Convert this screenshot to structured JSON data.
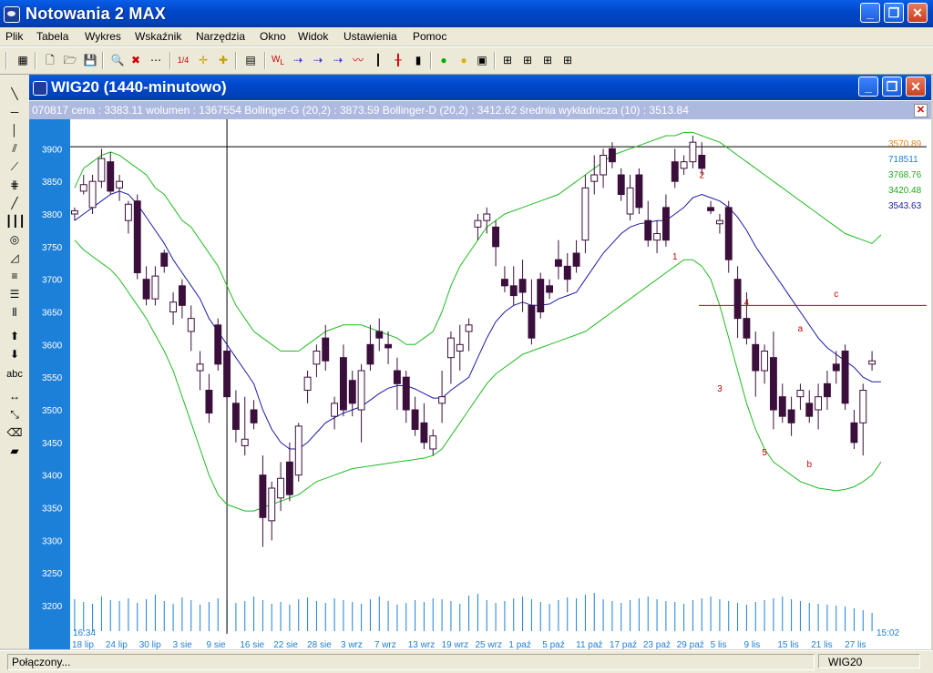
{
  "app": {
    "title": "Notowania 2 MAX"
  },
  "menu": [
    "Plik",
    "Tabela",
    "Wykres",
    "Wskaźnik",
    "Narzędzia",
    "Okno",
    "Widok",
    "Ustawienia",
    "Pomoc"
  ],
  "window": {
    "title": "WIG20 (1440-minutowo)"
  },
  "infobar": {
    "text": "070817  cena : 3383.11 wolumen : 1367554 Bollinger-G (20,2) : 3873.59 Bollinger-D (20,2) : 3412.62 średnia wykładnicza (10) : 3513.84"
  },
  "status": {
    "left": "Połączony...",
    "right": "WIG20"
  },
  "left_tools": [
    "line",
    "hline",
    "vline",
    "channel",
    "fan",
    "fib",
    "parallel",
    "vlines",
    "arc",
    "triangle",
    "ray",
    "hlines",
    "vbars",
    "up",
    "down",
    "abc",
    "arrows",
    "expand",
    "eraser",
    "eraser2"
  ],
  "toolbar_icons": [
    "grid",
    "open-folder",
    "save",
    "zoom",
    "no-zoom",
    "dots",
    "calc",
    "ruler",
    "mark",
    "table",
    "w-lv",
    "link1",
    "link2",
    "link3",
    "line-chart",
    "candles",
    "ohlc",
    "bar",
    "traffic",
    "light",
    "frame",
    "layout1",
    "layout2",
    "layout3",
    "layout4"
  ],
  "chart_data": {
    "type": "candlestick",
    "ylim": [
      3200,
      3920
    ],
    "yticks": [
      3900,
      3850,
      3800,
      3750,
      3700,
      3650,
      3600,
      3550,
      3500,
      3450,
      3400,
      3350,
      3300,
      3250,
      3200
    ],
    "time_label_left": "16:34",
    "time_label_right": "15:02",
    "xticks": [
      "18 lip",
      "24 lip",
      "30 lip",
      "3 sie",
      "9 sie",
      "16 sie",
      "22 sie",
      "28 sie",
      "3 wrz",
      "7 wrz",
      "13 wrz",
      "19 wrz",
      "25 wrz",
      "1 paź",
      "5 paź",
      "11 paź",
      "17 paź",
      "23 paź",
      "29 paź",
      "5 lis",
      "9 lis",
      "15 lis",
      "21 lis",
      "27 lis"
    ],
    "right_values": [
      {
        "text": "3570.89",
        "color": "#e08a1e"
      },
      {
        "text": "718511",
        "color": "#1c7fd8"
      },
      {
        "text": "3768.76",
        "color": "#22aa22"
      },
      {
        "text": "3420.48",
        "color": "#22aa22"
      },
      {
        "text": "3543.63",
        "color": "#1a1aa8"
      }
    ],
    "annotations": [
      {
        "text": "1",
        "x": 67,
        "y": 3730
      },
      {
        "text": "2",
        "x": 70,
        "y": 3855
      },
      {
        "text": "3",
        "x": 72,
        "y": 3528
      },
      {
        "text": "4",
        "x": 75,
        "y": 3660
      },
      {
        "text": "5",
        "x": 77,
        "y": 3430
      },
      {
        "text": "a",
        "x": 81,
        "y": 3620
      },
      {
        "text": "b",
        "x": 82,
        "y": 3412
      },
      {
        "text": "c",
        "x": 85,
        "y": 3673
      }
    ],
    "hline_price": 3660,
    "crosshair": {
      "x_index": 17,
      "price": 3903
    },
    "candles": [
      [
        3800,
        3810,
        3790,
        3805
      ],
      [
        3835,
        3860,
        3830,
        3845
      ],
      [
        3810,
        3860,
        3800,
        3850
      ],
      [
        3850,
        3900,
        3840,
        3885
      ],
      [
        3880,
        3895,
        3830,
        3835
      ],
      [
        3840,
        3860,
        3820,
        3850
      ],
      [
        3790,
        3820,
        3770,
        3815
      ],
      [
        3820,
        3830,
        3700,
        3710
      ],
      [
        3700,
        3720,
        3660,
        3670
      ],
      [
        3670,
        3720,
        3660,
        3705
      ],
      [
        3740,
        3745,
        3710,
        3720
      ],
      [
        3650,
        3680,
        3630,
        3665
      ],
      [
        3690,
        3700,
        3640,
        3660
      ],
      [
        3620,
        3660,
        3590,
        3640
      ],
      [
        3560,
        3590,
        3530,
        3570
      ],
      [
        3530,
        3555,
        3480,
        3495
      ],
      [
        3630,
        3640,
        3560,
        3570
      ],
      [
        3590,
        3600,
        3510,
        3520
      ],
      [
        3510,
        3530,
        3450,
        3470
      ],
      [
        3445,
        3520,
        3430,
        3455
      ],
      [
        3500,
        3515,
        3470,
        3480
      ],
      [
        3400,
        3430,
        3290,
        3335
      ],
      [
        3330,
        3390,
        3300,
        3380
      ],
      [
        3365,
        3420,
        3345,
        3395
      ],
      [
        3420,
        3450,
        3360,
        3370
      ],
      [
        3400,
        3480,
        3390,
        3475
      ],
      [
        3530,
        3560,
        3510,
        3550
      ],
      [
        3570,
        3600,
        3550,
        3590
      ],
      [
        3610,
        3630,
        3560,
        3575
      ],
      [
        3490,
        3520,
        3470,
        3510
      ],
      [
        3580,
        3600,
        3490,
        3500
      ],
      [
        3545,
        3560,
        3490,
        3510
      ],
      [
        3500,
        3570,
        3450,
        3560
      ],
      [
        3600,
        3630,
        3560,
        3570
      ],
      [
        3620,
        3640,
        3590,
        3610
      ],
      [
        3600,
        3620,
        3570,
        3595
      ],
      [
        3560,
        3580,
        3500,
        3540
      ],
      [
        3550,
        3560,
        3480,
        3500
      ],
      [
        3500,
        3520,
        3460,
        3470
      ],
      [
        3480,
        3510,
        3440,
        3450
      ],
      [
        3440,
        3470,
        3430,
        3460
      ],
      [
        3510,
        3560,
        3480,
        3520
      ],
      [
        3580,
        3620,
        3540,
        3610
      ],
      [
        3590,
        3630,
        3560,
        3600
      ],
      [
        3620,
        3640,
        3590,
        3630
      ],
      [
        3780,
        3800,
        3760,
        3790
      ],
      [
        3790,
        3810,
        3770,
        3800
      ],
      [
        3780,
        3790,
        3720,
        3750
      ],
      [
        3700,
        3720,
        3680,
        3690
      ],
      [
        3690,
        3720,
        3660,
        3675
      ],
      [
        3700,
        3730,
        3650,
        3680
      ],
      [
        3660,
        3700,
        3600,
        3610
      ],
      [
        3700,
        3710,
        3640,
        3650
      ],
      [
        3690,
        3700,
        3670,
        3680
      ],
      [
        3730,
        3760,
        3700,
        3720
      ],
      [
        3720,
        3740,
        3680,
        3700
      ],
      [
        3740,
        3760,
        3710,
        3720
      ],
      [
        3760,
        3860,
        3740,
        3840
      ],
      [
        3850,
        3890,
        3830,
        3860
      ],
      [
        3860,
        3900,
        3840,
        3890
      ],
      [
        3900,
        3910,
        3870,
        3880
      ],
      [
        3860,
        3870,
        3820,
        3830
      ],
      [
        3800,
        3860,
        3790,
        3840
      ],
      [
        3860,
        3870,
        3800,
        3810
      ],
      [
        3790,
        3820,
        3750,
        3760
      ],
      [
        3760,
        3790,
        3740,
        3770
      ],
      [
        3810,
        3830,
        3750,
        3760
      ],
      [
        3880,
        3900,
        3840,
        3850
      ],
      [
        3870,
        3890,
        3860,
        3880
      ],
      [
        3880,
        3920,
        3870,
        3910
      ],
      [
        3890,
        3910,
        3860,
        3870
      ],
      [
        3810,
        3820,
        3800,
        3805
      ],
      [
        3785,
        3800,
        3770,
        3790
      ],
      [
        3810,
        3820,
        3710,
        3730
      ],
      [
        3700,
        3720,
        3610,
        3640
      ],
      [
        3640,
        3680,
        3600,
        3610
      ],
      [
        3600,
        3620,
        3520,
        3560
      ],
      [
        3560,
        3600,
        3540,
        3590
      ],
      [
        3580,
        3620,
        3470,
        3500
      ],
      [
        3520,
        3540,
        3480,
        3490
      ],
      [
        3500,
        3520,
        3460,
        3480
      ],
      [
        3520,
        3540,
        3500,
        3530
      ],
      [
        3510,
        3530,
        3480,
        3490
      ],
      [
        3500,
        3540,
        3470,
        3520
      ],
      [
        3540,
        3560,
        3500,
        3520
      ],
      [
        3570,
        3590,
        3540,
        3560
      ],
      [
        3590,
        3600,
        3500,
        3510
      ],
      [
        3480,
        3500,
        3440,
        3450
      ],
      [
        3480,
        3540,
        3430,
        3530
      ],
      [
        3570,
        3590,
        3560,
        3575
      ]
    ],
    "bollinger_upper": [
      3840,
      3870,
      3880,
      3890,
      3895,
      3890,
      3880,
      3870,
      3860,
      3840,
      3830,
      3810,
      3790,
      3780,
      3760,
      3740,
      3720,
      3690,
      3660,
      3640,
      3620,
      3610,
      3600,
      3590,
      3590,
      3590,
      3600,
      3610,
      3620,
      3625,
      3630,
      3630,
      3630,
      3625,
      3620,
      3615,
      3610,
      3600,
      3600,
      3610,
      3620,
      3650,
      3690,
      3720,
      3740,
      3760,
      3780,
      3790,
      3800,
      3805,
      3810,
      3815,
      3820,
      3825,
      3830,
      3840,
      3850,
      3860,
      3870,
      3880,
      3890,
      3895,
      3900,
      3905,
      3910,
      3915,
      3920,
      3920,
      3925,
      3925,
      3920,
      3915,
      3910,
      3900,
      3890,
      3880,
      3870,
      3860,
      3850,
      3840,
      3830,
      3820,
      3810,
      3800,
      3790,
      3780,
      3770,
      3765,
      3760,
      3755,
      3768
    ],
    "bollinger_lower": [
      3760,
      3745,
      3735,
      3725,
      3715,
      3700,
      3680,
      3660,
      3640,
      3615,
      3590,
      3560,
      3520,
      3480,
      3440,
      3400,
      3370,
      3355,
      3350,
      3345,
      3345,
      3350,
      3355,
      3360,
      3365,
      3370,
      3380,
      3390,
      3395,
      3400,
      3405,
      3410,
      3412,
      3414,
      3416,
      3418,
      3420,
      3422,
      3424,
      3426,
      3430,
      3440,
      3460,
      3480,
      3500,
      3520,
      3540,
      3555,
      3565,
      3575,
      3585,
      3590,
      3595,
      3600,
      3605,
      3610,
      3615,
      3620,
      3630,
      3640,
      3650,
      3660,
      3670,
      3680,
      3690,
      3700,
      3710,
      3720,
      3730,
      3730,
      3720,
      3700,
      3660,
      3610,
      3560,
      3510,
      3470,
      3440,
      3420,
      3410,
      3400,
      3390,
      3385,
      3380,
      3378,
      3376,
      3378,
      3382,
      3390,
      3400,
      3420
    ],
    "ema": [
      3790,
      3800,
      3810,
      3820,
      3830,
      3835,
      3830,
      3815,
      3795,
      3775,
      3755,
      3730,
      3710,
      3690,
      3670,
      3640,
      3620,
      3600,
      3580,
      3560,
      3540,
      3500,
      3470,
      3450,
      3440,
      3440,
      3450,
      3465,
      3480,
      3488,
      3495,
      3500,
      3505,
      3515,
      3525,
      3533,
      3537,
      3537,
      3532,
      3525,
      3518,
      3518,
      3530,
      3540,
      3550,
      3580,
      3610,
      3635,
      3650,
      3660,
      3665,
      3660,
      3660,
      3662,
      3670,
      3675,
      3680,
      3700,
      3720,
      3740,
      3755,
      3770,
      3780,
      3785,
      3787,
      3790,
      3790,
      3800,
      3810,
      3825,
      3830,
      3825,
      3820,
      3810,
      3795,
      3775,
      3750,
      3730,
      3710,
      3690,
      3670,
      3650,
      3630,
      3610,
      3595,
      3585,
      3575,
      3565,
      3550,
      3543,
      3543
    ],
    "volume": [
      35,
      32,
      30,
      38,
      34,
      33,
      36,
      31,
      35,
      40,
      33,
      30,
      37,
      34,
      29,
      32,
      36,
      35,
      31,
      33,
      38,
      34,
      30,
      32,
      29,
      35,
      37,
      33,
      31,
      36,
      34,
      32,
      30,
      35,
      38,
      33,
      29,
      31,
      34,
      32,
      36,
      35,
      33,
      30,
      39,
      41,
      34,
      31,
      33,
      36,
      38,
      35,
      32,
      30,
      34,
      37,
      36,
      40,
      42,
      35,
      33,
      31,
      34,
      36,
      38,
      35,
      33,
      32,
      30,
      34,
      36,
      38,
      35,
      33,
      31,
      29,
      32,
      34,
      36,
      38,
      35,
      33,
      31,
      30,
      29,
      28,
      27,
      25,
      23,
      20
    ]
  }
}
